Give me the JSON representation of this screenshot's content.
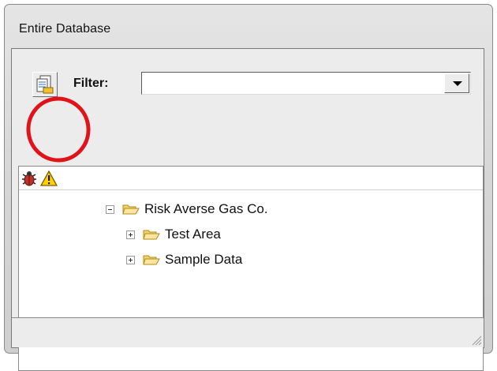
{
  "window": {
    "title": "Entire Database"
  },
  "toolbar": {
    "report_icon": "report-document-icon",
    "filter_label": "Filter:",
    "filter_value": "",
    "filter_placeholder": "",
    "dropdown_icon": "chevron-down-icon"
  },
  "icon_strip": {
    "bug_icon": "bug-icon",
    "warning_icon": "warning-icon"
  },
  "tree": {
    "root": {
      "label": "Risk Averse Gas Co.",
      "expanded": true
    },
    "children": [
      {
        "label": "Test Area",
        "expanded": false
      },
      {
        "label": "Sample Data",
        "expanded": false
      }
    ]
  },
  "colors": {
    "highlight_ring": "#e0121a",
    "folder_fill": "#f6d36a",
    "folder_stroke": "#b08a1a",
    "warning_fill": "#ffd200"
  }
}
